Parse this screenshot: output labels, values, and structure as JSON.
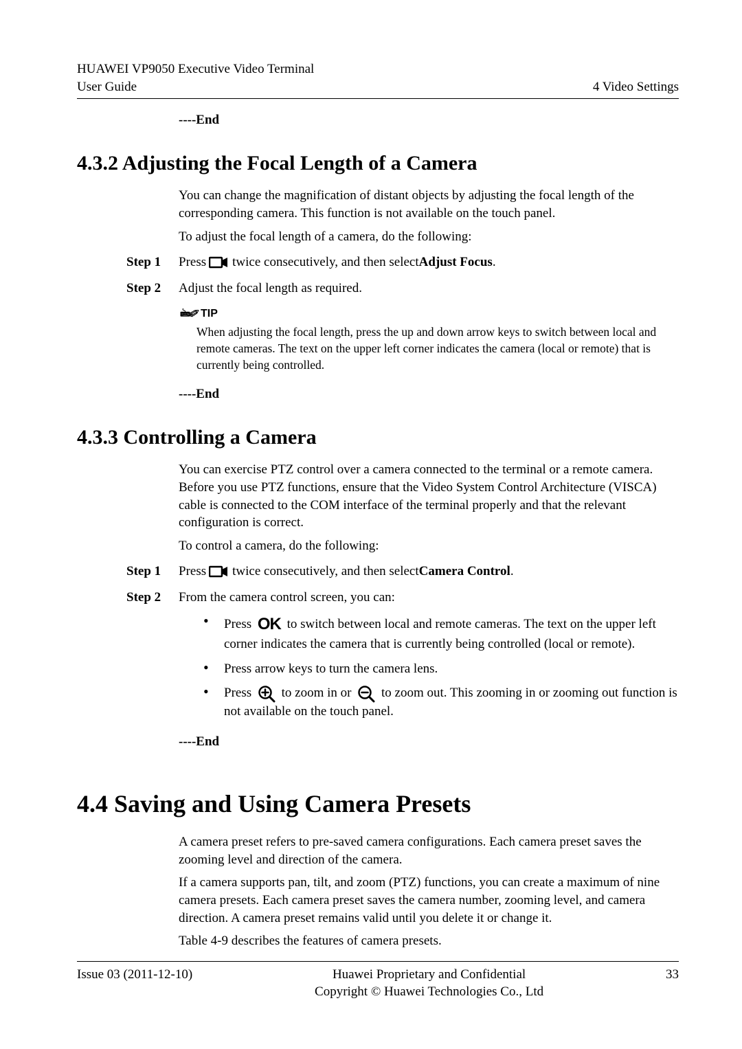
{
  "header": {
    "product_line1": "HUAWEI VP9050 Executive Video Terminal",
    "product_line2": "User Guide",
    "chapter": "4 Video Settings"
  },
  "preend": "----End",
  "sec432": {
    "title": "4.3.2 Adjusting the Focal Length of a Camera",
    "p1": "You can change the magnification of distant objects by adjusting the focal length of the corresponding camera. This function is not available on the touch panel.",
    "p2": "To adjust the focal length of a camera, do the following:",
    "step1_label": "Step 1",
    "step1_a": "Press ",
    "step1_b": " twice consecutively, and then select ",
    "step1_bold": "Adjust Focus",
    "step1_c": ".",
    "step2_label": "Step 2",
    "step2_body": "Adjust the focal length as required.",
    "tip_label": "TIP",
    "tip_body": "When adjusting the focal length, press the up and down arrow keys to switch between local and remote cameras. The text on the upper left corner indicates the camera (local or remote) that is currently being controlled.",
    "end": "----End"
  },
  "sec433": {
    "title": "4.3.3 Controlling a Camera",
    "p1": "You can exercise PTZ control over a camera connected to the terminal or a remote camera. Before you use PTZ functions, ensure that the Video System Control Architecture (VISCA) cable is connected to the COM interface of the terminal properly and that the relevant configuration is correct.",
    "p2": "To control a camera, do the following:",
    "step1_label": "Step 1",
    "step1_a": "Press ",
    "step1_b": " twice consecutively, and then select ",
    "step1_bold": "Camera Control",
    "step1_c": ".",
    "step2_label": "Step 2",
    "step2_body": "From the camera control screen, you can:",
    "b1_a": "Press ",
    "b1_ok": "OK",
    "b1_b": " to switch between local and remote cameras. The text on the upper left corner indicates the camera that is currently being controlled (local or remote).",
    "b2": "Press arrow keys to turn the camera lens.",
    "b3_a": "Press ",
    "b3_b": " to zoom in or ",
    "b3_c": " to zoom out. This zooming in or zooming out function is not available on the touch panel.",
    "end": "----End"
  },
  "sec44": {
    "title": "4.4 Saving and Using Camera Presets",
    "p1": "A camera preset refers to pre-saved camera configurations. Each camera preset saves the zooming level and direction of the camera.",
    "p2": "If a camera supports pan, tilt, and zoom (PTZ) functions, you can create a maximum of nine camera presets. Each camera preset saves the camera number, zooming level, and camera direction. A camera preset remains valid until you delete it or change it.",
    "p3": "Table 4-9 describes the features of camera presets."
  },
  "footer": {
    "issue": "Issue 03 (2011-12-10)",
    "center1": "Huawei Proprietary and Confidential",
    "center2": "Copyright © Huawei Technologies Co., Ltd",
    "page": "33"
  }
}
